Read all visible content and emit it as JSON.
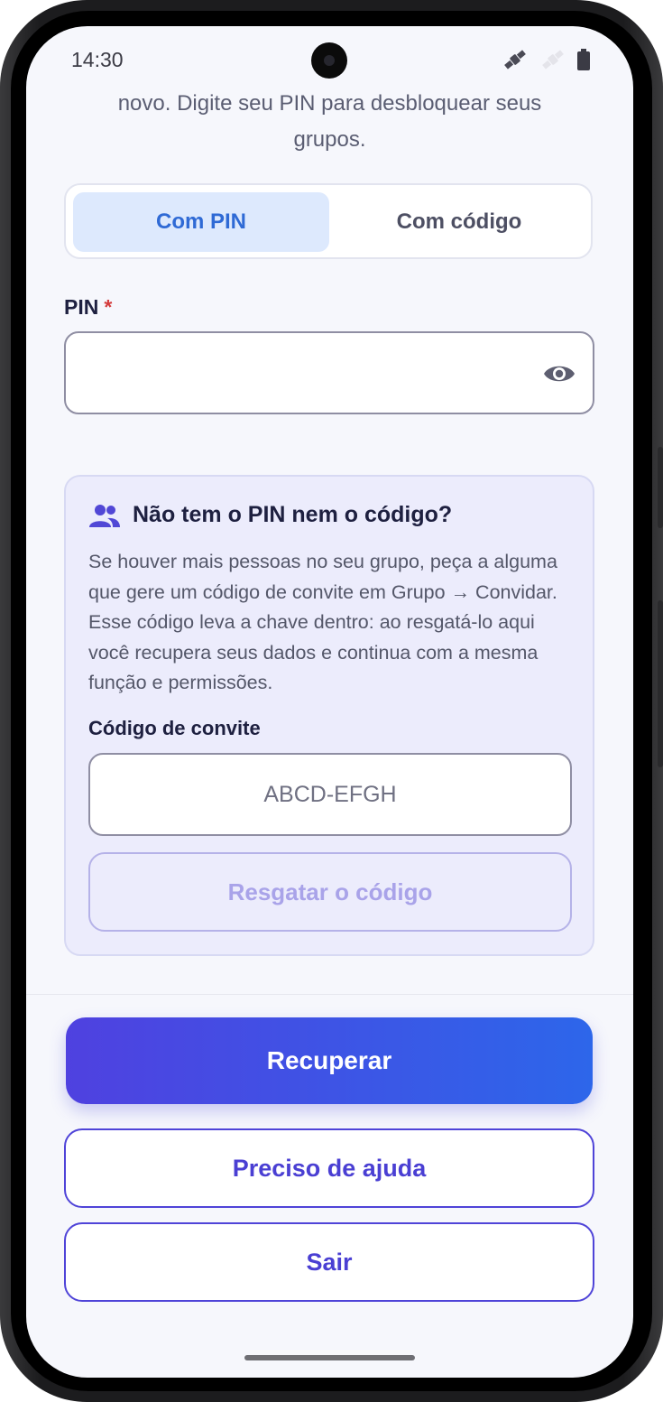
{
  "status_bar": {
    "time": "14:30"
  },
  "intro": {
    "line1": "novo. Digite seu PIN para desbloquear seus",
    "line2": "grupos."
  },
  "tabs": [
    {
      "label": "Com PIN",
      "active": true
    },
    {
      "label": "Com código",
      "active": false
    }
  ],
  "pin": {
    "label": "PIN",
    "required_mark": "*",
    "value": "",
    "visibility_icon": "eye-icon"
  },
  "help_card": {
    "icon": "group-icon",
    "title": "Não tem o PIN nem o código?",
    "text": "Se houver mais pessoas no seu grupo, peça a alguma que gere um código de convite em Grupo → Convidar. Esse código leva a chave dentro: ao resgatá-lo aqui você recupera seus dados e continua com a mesma função e permissões.",
    "invite_label": "Código de convite",
    "invite_placeholder": "ABCD-EFGH",
    "redeem_label": "Resgatar o código"
  },
  "actions": {
    "recover_label": "Recuperar",
    "help_label": "Preciso de ajuda",
    "exit_label": "Sair"
  },
  "colors": {
    "primary_gradient_start": "#4f41e0",
    "primary_gradient_end": "#2d66ea",
    "accent": "#4a3fd3",
    "active_tab_bg": "#dde9fd",
    "active_tab_text": "#2f6ad5",
    "card_bg": "#ececfc",
    "required": "#d43b3b"
  }
}
